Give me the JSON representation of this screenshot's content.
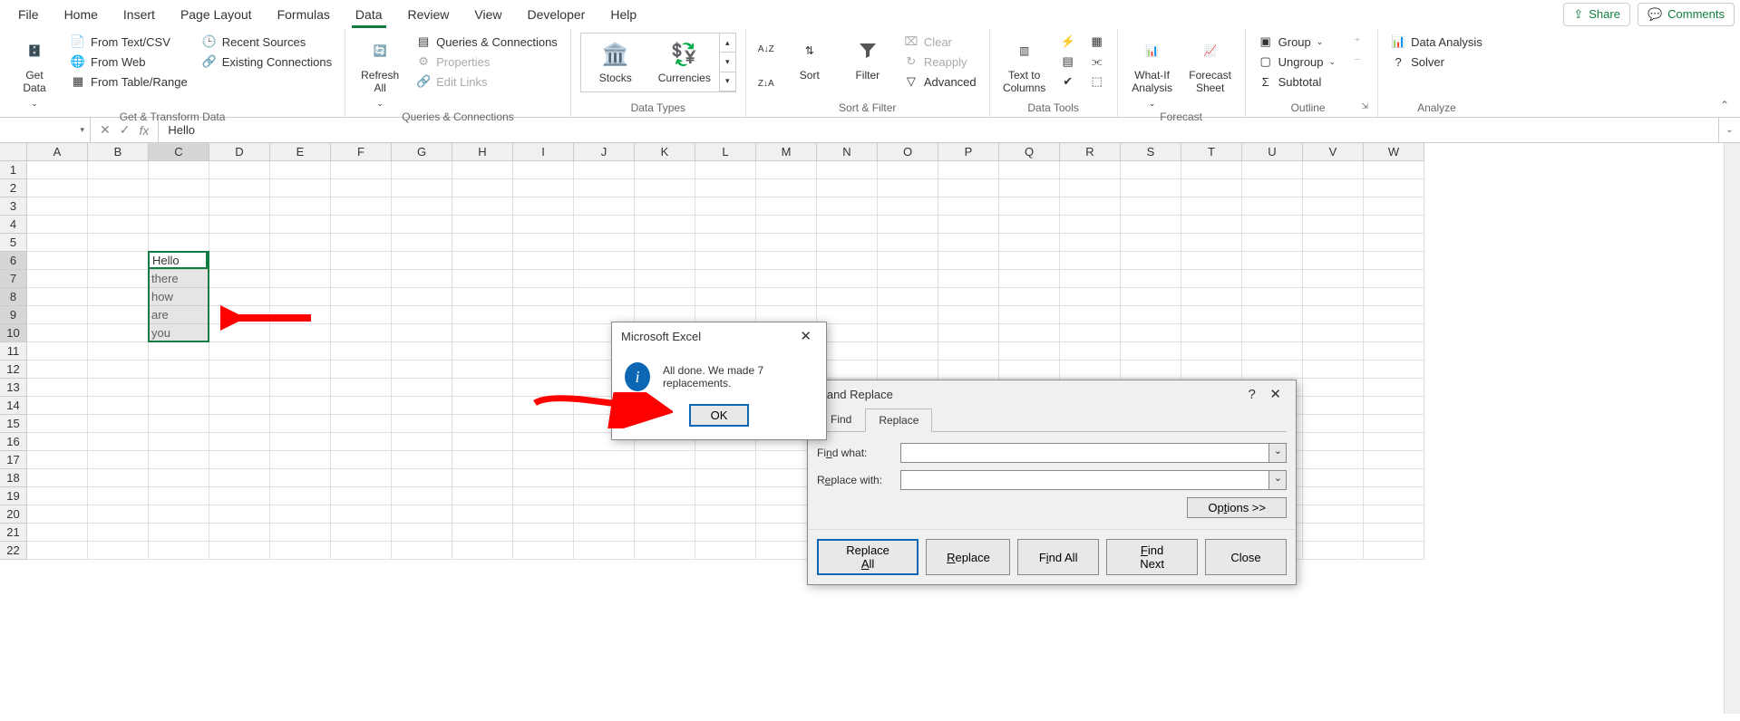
{
  "tabs": [
    "File",
    "Home",
    "Insert",
    "Page Layout",
    "Formulas",
    "Data",
    "Review",
    "View",
    "Developer",
    "Help"
  ],
  "active_tab": "Data",
  "share": "Share",
  "comments": "Comments",
  "ribbon": {
    "get_data": "Get\nData",
    "from_textcsv": "From Text/CSV",
    "from_web": "From Web",
    "from_table": "From Table/Range",
    "recent_sources": "Recent Sources",
    "existing_conn": "Existing Connections",
    "group1": "Get & Transform Data",
    "refresh_all": "Refresh\nAll",
    "queries_conn": "Queries & Connections",
    "properties": "Properties",
    "edit_links": "Edit Links",
    "group2": "Queries & Connections",
    "stocks": "Stocks",
    "currencies": "Currencies",
    "group3": "Data Types",
    "sort": "Sort",
    "filter": "Filter",
    "clear": "Clear",
    "reapply": "Reapply",
    "advanced": "Advanced",
    "group4": "Sort & Filter",
    "text_to_columns": "Text to\nColumns",
    "group5": "Data Tools",
    "whatif": "What-If\nAnalysis",
    "forecast_sheet": "Forecast\nSheet",
    "group6": "Forecast",
    "group_btn": "Group",
    "ungroup": "Ungroup",
    "subtotal": "Subtotal",
    "group7": "Outline",
    "data_analysis": "Data Analysis",
    "solver": "Solver",
    "group8": "Analyze"
  },
  "namebox": "",
  "formula": "Hello",
  "columns": [
    "A",
    "B",
    "C",
    "D",
    "E",
    "F",
    "G",
    "H",
    "I",
    "J",
    "K",
    "L",
    "M",
    "N",
    "O",
    "P",
    "Q",
    "R",
    "S",
    "T",
    "U",
    "V",
    "W"
  ],
  "rows": [
    1,
    2,
    3,
    4,
    5,
    6,
    7,
    8,
    9,
    10,
    11,
    12,
    13,
    14,
    15,
    16,
    17,
    18,
    19,
    20,
    21,
    22
  ],
  "cell_data": {
    "6": "Hello",
    "7": "there",
    "8": "how",
    "9": "are",
    "10": "you"
  },
  "selected_col": "C",
  "selected_rows": [
    6,
    7,
    8,
    9,
    10
  ],
  "msgbox": {
    "title": "Microsoft Excel",
    "text": "All done. We made 7 replacements.",
    "ok": "OK"
  },
  "findrepl": {
    "title_partial": "d and Replace",
    "help": "?",
    "tab_find": "Find",
    "tab_replace": "Replace",
    "find_what": "Find what:",
    "replace_with": "Replace with:",
    "find_val": "",
    "replace_val": "",
    "options": "Options >>",
    "replace_all": "Replace All",
    "replace": "Replace",
    "find_all": "Find All",
    "find_next": "Find Next",
    "close": "Close"
  }
}
